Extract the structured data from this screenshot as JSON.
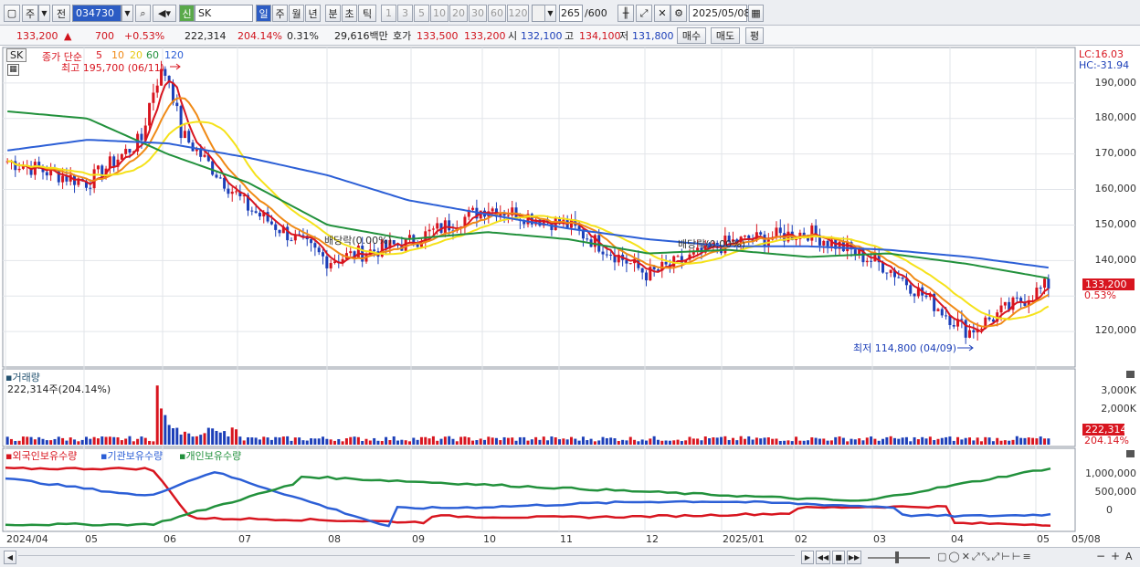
{
  "toolbar": {
    "period_mode": "주",
    "code_prefix": "전",
    "stock_code": "034730",
    "stock_name": "SK",
    "new_badge": "신",
    "tabs": [
      "일",
      "주",
      "월",
      "년",
      "분",
      "초",
      "틱"
    ],
    "active_tab": "일",
    "intervals": [
      "1",
      "3",
      "5",
      "10",
      "20",
      "30",
      "60",
      "120"
    ],
    "count_display": "265",
    "count_max": "/600",
    "date": "2025/05/08"
  },
  "infobar": {
    "price": "133,200",
    "change_arrow": "▲",
    "change": "700",
    "change_pct": "+0.53%",
    "volume": "222,314",
    "volume_ratio": "204.14%",
    "turnover": "0.31%",
    "trade_value": "29,616백만",
    "quote_label": "호가",
    "ask": "133,500",
    "bid": "133,200",
    "open_label": "시",
    "open": "132,100",
    "high_label": "고",
    "high": "134,100",
    "low_label": "저",
    "low": "131,800",
    "buy_button": "매수",
    "sell_button": "매도",
    "eval_button": "평"
  },
  "price_panel": {
    "name_tag": "SK",
    "ma_label": "종가 단순",
    "ma_periods": [
      "5",
      "10",
      "20",
      "60",
      "120"
    ],
    "ma_colors": [
      "#d8151f",
      "#f08a16",
      "#f5e21a",
      "#22913c",
      "#2c5fd6"
    ],
    "high_marker": "최고 195,700 (06/11)",
    "low_marker": "최저 114,800 (04/09)",
    "dividend_label_1": "배당락(0.00%)",
    "dividend_label_2": "배당락(0.00%)",
    "lc": "LC:16.03",
    "hc": "HC:-31.94",
    "current_tag": "133,200",
    "current_pct": "0.53%",
    "y_ticks": [
      "190,000",
      "180,000",
      "170,000",
      "160,000",
      "150,000",
      "140,000",
      "120,000"
    ]
  },
  "volume_panel": {
    "title": "거래량",
    "value_line": "222,314주(204.14%)",
    "y_ticks": [
      "3,000K",
      "2,000K",
      "1,000K"
    ],
    "current_tag": "222,314",
    "current_pct": "204.14%"
  },
  "holding_panel": {
    "series_names": [
      "외국인보유수량",
      "기관보유수량",
      "개인보유수량"
    ],
    "series_colors": [
      "#d8151f",
      "#2c5fd6",
      "#22913c"
    ],
    "y_ticks": [
      "1,000,000",
      "500,000",
      "0"
    ]
  },
  "x_axis": {
    "labels": [
      "2024/04",
      "05",
      "06",
      "07",
      "08",
      "09",
      "10",
      "11",
      "12",
      "2025/01",
      "02",
      "03",
      "04",
      "05",
      "05/08"
    ]
  },
  "chart_data": {
    "type": "line",
    "title": "SK",
    "xlabel": "",
    "ylabel": "",
    "ylim": [
      110000,
      200000
    ],
    "x": [
      "2024/04",
      "2024/05",
      "2024/06",
      "2024/07",
      "2024/08",
      "2024/09",
      "2024/10",
      "2024/11",
      "2024/12",
      "2025/01",
      "2025/02",
      "2025/03",
      "2025/04",
      "2025/05"
    ],
    "series": [
      {
        "name": "5",
        "values": [
          168000,
          162000,
          180000,
          155000,
          140000,
          145000,
          155000,
          150000,
          136000,
          145000,
          148000,
          138000,
          120000,
          133200
        ]
      },
      {
        "name": "60",
        "values": [
          182000,
          180000,
          170000,
          162000,
          150000,
          146000,
          148000,
          146000,
          142000,
          143000,
          141000,
          142000,
          139000,
          135000
        ]
      },
      {
        "name": "120",
        "values": [
          171000,
          174000,
          173000,
          169000,
          164000,
          157000,
          153000,
          149000,
          146000,
          144000,
          144000,
          143000,
          141000,
          138000
        ]
      }
    ],
    "annotations": [
      "최고 195,700 (06/11)",
      "최저 114,800 (04/09)"
    ]
  }
}
